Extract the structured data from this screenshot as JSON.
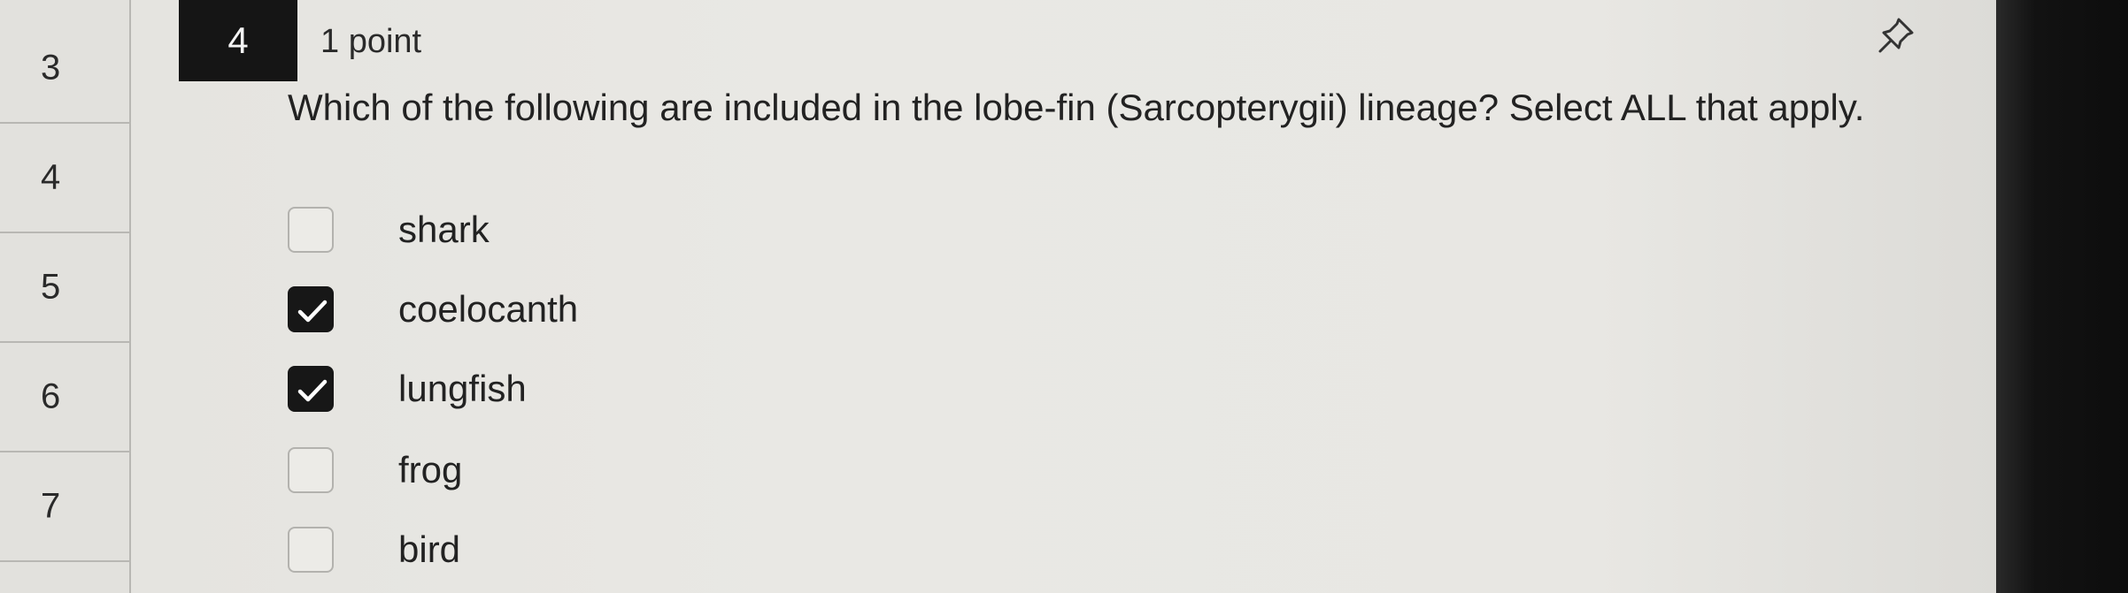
{
  "nav": {
    "items": [
      {
        "label": "3"
      },
      {
        "label": "4"
      },
      {
        "label": "5"
      },
      {
        "label": "6"
      },
      {
        "label": "7"
      }
    ]
  },
  "question": {
    "number": "4",
    "points": "1 point",
    "text": "Which of the following are included in the lobe-fin (Sarcopterygii) lineage? Select ALL that apply.",
    "pin_icon": "pin-icon",
    "options": [
      {
        "label": "shark",
        "checked": false
      },
      {
        "label": "coelocanth",
        "checked": true
      },
      {
        "label": "lungfish",
        "checked": true
      },
      {
        "label": "frog",
        "checked": false
      },
      {
        "label": "bird",
        "checked": false
      }
    ]
  }
}
